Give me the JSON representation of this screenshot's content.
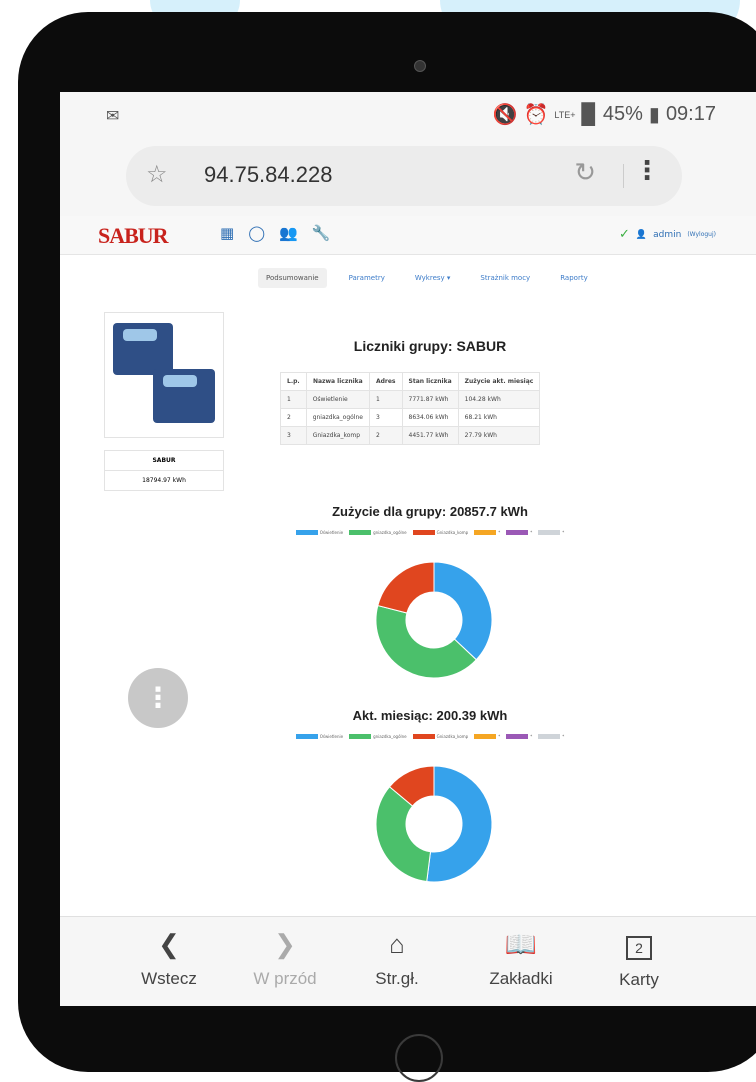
{
  "status": {
    "signal_text": "LTE+",
    "battery": "45%",
    "time": "09:17"
  },
  "browser": {
    "url": "94.75.84.228"
  },
  "app": {
    "logo": "SABUR",
    "user": "admin",
    "logout": "(Wyloguj)",
    "tabs": [
      "Podsumowanie",
      "Parametry",
      "Wykresy ▾",
      "Strażnik mocy",
      "Raporty"
    ],
    "device_label": "SABUR",
    "device_value": "18794.97 kWh"
  },
  "table": {
    "title": "Liczniki grupy: SABUR",
    "headers": [
      "L.p.",
      "Nazwa licznika",
      "Adres",
      "Stan licznika",
      "Zużycie akt. miesiąc"
    ],
    "rows": [
      [
        "1",
        "Oświetlenie",
        "1",
        "7771.87 kWh",
        "104.28 kWh"
      ],
      [
        "2",
        "gniazdka_ogólne",
        "3",
        "8634.06 kWh",
        "68.21 kWh"
      ],
      [
        "3",
        "Gniazdka_komp",
        "2",
        "4451.77 kWh",
        "27.79 kWh"
      ]
    ]
  },
  "chart_data": [
    {
      "type": "pie",
      "title": "Zużycie dla grupy: 20857.7 kWh",
      "categories": [
        "Oświetlenie",
        "gniazdka_ogólne",
        "Gniazdka_komp",
        "*",
        "*",
        "*"
      ],
      "values": [
        37,
        42,
        21,
        0,
        0,
        0
      ],
      "colors": [
        "#36a2eb",
        "#4bc06b",
        "#e0461f",
        "#f5a623",
        "#9b59b6",
        "#cfd4d9"
      ]
    },
    {
      "type": "pie",
      "title": "Akt. miesiąc: 200.39 kWh",
      "categories": [
        "Oświetlenie",
        "gniazdka_ogólne",
        "Gniazdka_komp",
        "*",
        "*",
        "*"
      ],
      "values": [
        52.0,
        34.1,
        13.9,
        0,
        0,
        0
      ],
      "colors": [
        "#36a2eb",
        "#4bc06b",
        "#e0461f",
        "#f5a623",
        "#9b59b6",
        "#cfd4d9"
      ]
    }
  ],
  "bottom_bar": {
    "back": "Wstecz",
    "forward": "W przód",
    "home": "Str.gł.",
    "bookmarks": "Zakładki",
    "tabs": "Karty",
    "tabs_count": "2"
  }
}
